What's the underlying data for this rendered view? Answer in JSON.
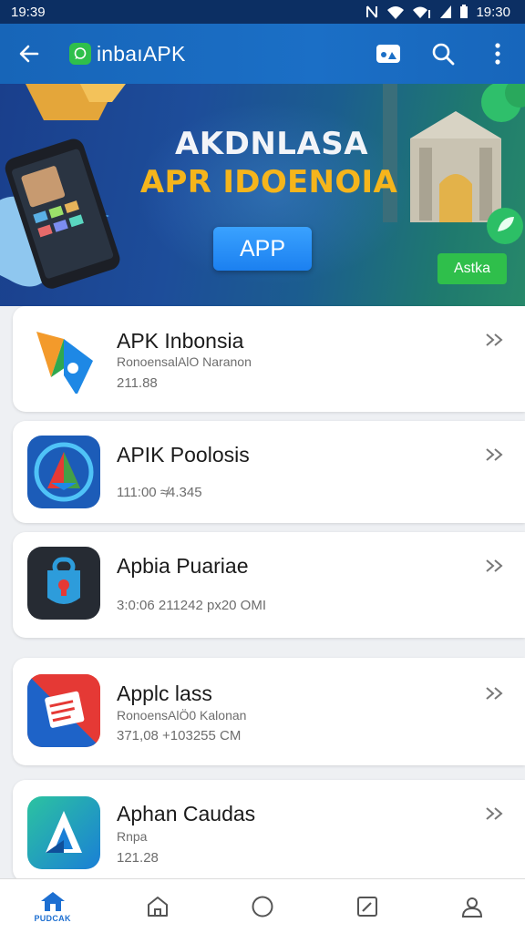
{
  "status_bar": {
    "time_left": "19:39",
    "time_right": "19:30"
  },
  "app_bar": {
    "title": "inbaıAPK"
  },
  "banner": {
    "headline": "AKDNLASA",
    "subheadline": "APR IDOENOIA",
    "cta_label": "APP",
    "small_button_label": "Astka"
  },
  "apps": [
    {
      "name": "APK Inbonsia",
      "line1": "RonoensalAlO Naranon",
      "line2": "211.88"
    },
    {
      "name": "APIK Poolosis",
      "line1": "",
      "line2": "111:00    ≉4.345"
    },
    {
      "name": "Apbia Puariae",
      "line1": "",
      "line2": "3:0:06       211242 px20 OMI"
    },
    {
      "name": "Applc lass",
      "line1": "RonoensAlÖ0 Kalonan",
      "line2": "371,08    +103255 CM"
    },
    {
      "name": "Aphan Caudas",
      "line1": "Rnpa",
      "line2": "121.28"
    }
  ],
  "bottom_nav": {
    "items": [
      {
        "label": "PUDCAK",
        "icon": "home-icon",
        "active": true
      },
      {
        "label": "",
        "icon": "house-outline-icon"
      },
      {
        "label": "",
        "icon": "circle-icon"
      },
      {
        "label": "",
        "icon": "edit-icon"
      },
      {
        "label": "",
        "icon": "profile-icon"
      }
    ]
  },
  "colors": {
    "app_bar": "#1b6fc6",
    "status_bar": "#0c2f63",
    "accent": "#1d6fd1",
    "banner_gold": "#f5b51c",
    "banner_button": "#1b80f0"
  }
}
